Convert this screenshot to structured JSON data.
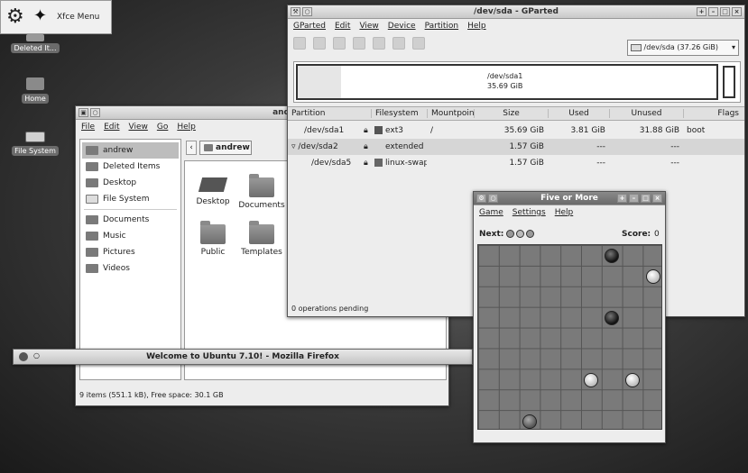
{
  "panel": {
    "menu_label": "Xfce Menu"
  },
  "desktop_icons": [
    {
      "label": "Deleted It..."
    },
    {
      "label": "Home"
    },
    {
      "label": "File System"
    }
  ],
  "gparted": {
    "title": "/dev/sda - GParted",
    "menu": [
      "GParted",
      "Edit",
      "View",
      "Device",
      "Partition",
      "Help"
    ],
    "device_selector": "/dev/sda  (37.26 GiB)",
    "partition_visual": {
      "name": "/dev/sda1",
      "size": "35.69 GiB"
    },
    "columns": [
      "Partition",
      "Filesystem",
      "Mountpoint",
      "Size",
      "Used",
      "Unused",
      "Flags"
    ],
    "rows": [
      {
        "partition": "/dev/sda1",
        "filesystem": "ext3",
        "mountpoint": "/",
        "size": "35.69 GiB",
        "used": "3.81 GiB",
        "unused": "31.88 GiB",
        "flags": "boot"
      },
      {
        "partition": "/dev/sda2",
        "filesystem": "extended",
        "mountpoint": "",
        "size": "1.57 GiB",
        "used": "---",
        "unused": "---",
        "flags": ""
      },
      {
        "partition": "/dev/sda5",
        "filesystem": "linux-swap",
        "mountpoint": "",
        "size": "1.57 GiB",
        "used": "---",
        "unused": "---",
        "flags": ""
      }
    ],
    "status": "0 operations pending"
  },
  "filemanager": {
    "title": "andrew - File Mana",
    "menu": [
      "File",
      "Edit",
      "View",
      "Go",
      "Help"
    ],
    "sidebar": [
      "andrew",
      "Deleted Items",
      "Desktop",
      "File System",
      "Documents",
      "Music",
      "Pictures",
      "Videos"
    ],
    "path_button": "andrew",
    "items": [
      "Desktop",
      "Documents",
      "Public",
      "Templates"
    ],
    "status": "9 items (551.1 kB), Free space: 30.1 GB"
  },
  "firefox": {
    "title": "Welcome to Ubuntu 7.10! - Mozilla Firefox"
  },
  "game": {
    "title": "Five or More",
    "menu": [
      "Game",
      "Settings",
      "Help"
    ],
    "next_label": "Next:",
    "score_label": "Score:",
    "score_value": "0"
  },
  "colors": {
    "desktop": "#4a4a4a",
    "window": "#ededed",
    "board": "#7a7a7a"
  }
}
